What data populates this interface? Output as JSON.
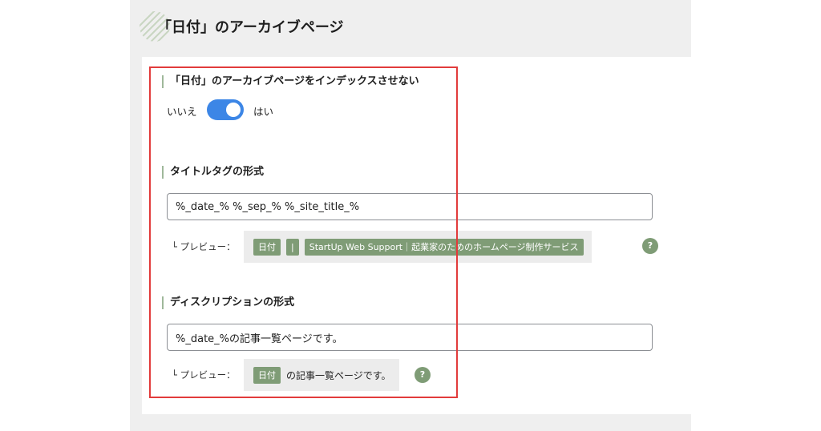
{
  "page": {
    "title": "「日付」のアーカイブページ"
  },
  "noindex": {
    "label": "「日付」のアーカイブページをインデックスさせない",
    "off_label": "いいえ",
    "on_label": "はい",
    "enabled": true
  },
  "title_tag": {
    "label": "タイトルタグの形式",
    "value": "%_date_% %_sep_% %_site_title_%",
    "preview_label": "└ プレビュー：",
    "preview_chips": [
      "日付",
      "|",
      "StartUp Web Support｜起業家のためのホームページ制作サービス"
    ],
    "help": "?"
  },
  "description": {
    "label": "ディスクリプションの形式",
    "value": "%_date_%の記事一覧ページです。",
    "preview_label": "└ プレビュー：",
    "preview_chip": "日付",
    "preview_text": "の記事一覧ページです。",
    "help": "?"
  },
  "colors": {
    "accent_green": "#7f9c76",
    "toggle_blue": "#3c86e6",
    "highlight_red": "#e23b3b"
  }
}
